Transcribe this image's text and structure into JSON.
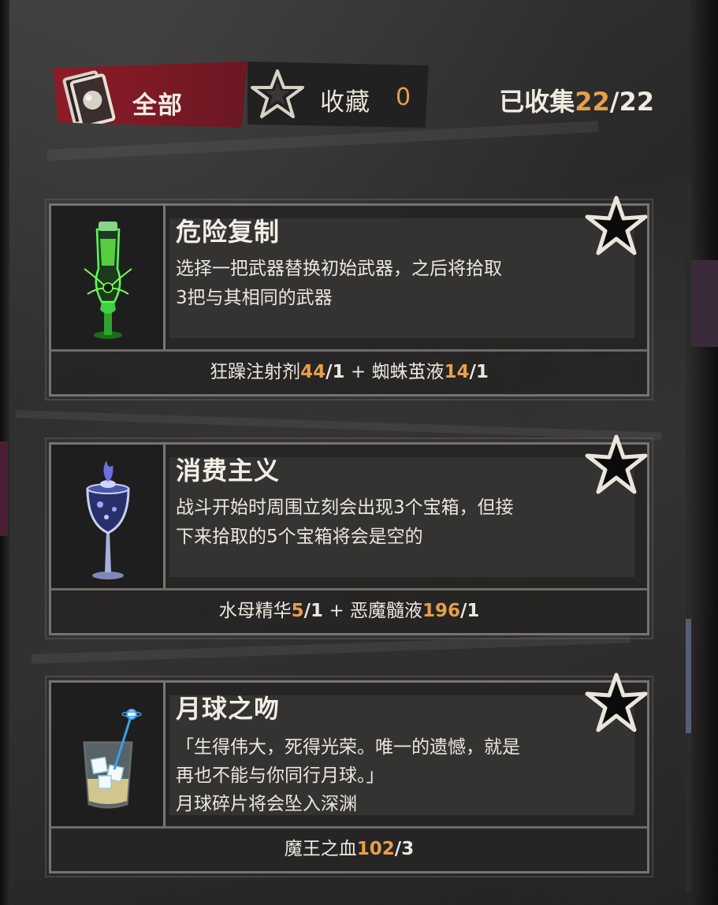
{
  "header": {
    "tab_all_label": "全部",
    "tab_fav_label": "收藏",
    "tab_fav_count": "0",
    "collected_label": "已收集",
    "collected_have": "22",
    "collected_sep": "/",
    "collected_total": "22"
  },
  "cards": [
    {
      "title": "危险复制",
      "desc_lines": [
        "选择一把武器替换初始武器，之后将拾取",
        "3把与其相同的武器"
      ],
      "icon": "green-bottle-icon",
      "ingredients": [
        {
          "name": "狂躁注射剂",
          "have": "44",
          "need": "/1"
        },
        {
          "name": "蜘蛛茧液",
          "have": "14",
          "need": "/1"
        }
      ],
      "plus": " + "
    },
    {
      "title": "消费主义",
      "desc_lines": [
        "战斗开始时周围立刻会出现3个宝箱，但接",
        "下来拾取的5个宝箱将会是空的"
      ],
      "icon": "blue-goblet-icon",
      "ingredients": [
        {
          "name": "水母精华",
          "have": "5",
          "need": "/1"
        },
        {
          "name": "恶魔髓液",
          "have": "196",
          "need": "/1"
        }
      ],
      "plus": " + "
    },
    {
      "title": "月球之吻",
      "desc_lines": [
        "「生得伟大，死得光荣。唯一的遗憾，就是",
        "再也不能与你同行月球。」",
        "月球碎片将会坠入深渊"
      ],
      "icon": "ice-glass-icon",
      "ingredients": [
        {
          "name": "魔王之血",
          "have": "102",
          "need": "/3"
        }
      ]
    }
  ],
  "colors": {
    "accent_red": "#8d1b28",
    "number_orange": "#e5a04a",
    "card_border": "#777370"
  }
}
